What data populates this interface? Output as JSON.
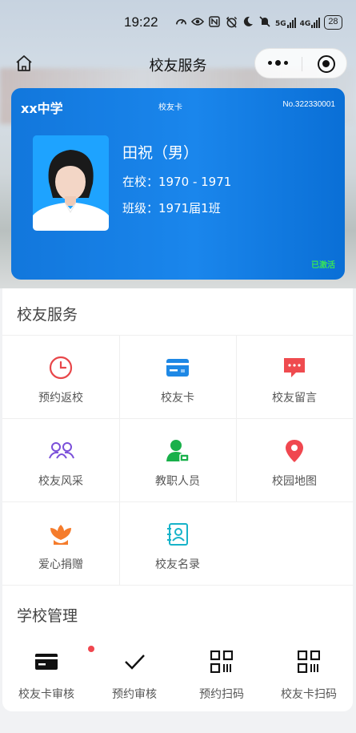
{
  "status_bar": {
    "time": "19:22",
    "signal1": "5G",
    "signal2": "4G",
    "battery": "28"
  },
  "nav": {
    "title": "校友服务"
  },
  "card": {
    "school": "xx中学",
    "card_type": "校友卡",
    "number": "No.322330001",
    "name": "田祝（男）",
    "school_years": "在校：1970 - 1971",
    "class": "班级：1971届1班",
    "status": "已激活"
  },
  "alumni_services": {
    "title": "校友服务",
    "items": [
      {
        "label": "预约返校",
        "icon": "clock-icon",
        "color": "#e8474a"
      },
      {
        "label": "校友卡",
        "icon": "card-icon",
        "color": "#1e88e5"
      },
      {
        "label": "校友留言",
        "icon": "message-icon",
        "color": "#ef4b4f"
      },
      {
        "label": "校友风采",
        "icon": "people-icon",
        "color": "#7a4fd9"
      },
      {
        "label": "教职人员",
        "icon": "staff-icon",
        "color": "#19b04a"
      },
      {
        "label": "校园地图",
        "icon": "map-pin-icon",
        "color": "#f0474f"
      },
      {
        "label": "爱心捐赠",
        "icon": "donate-icon",
        "color": "#f57c2c"
      },
      {
        "label": "校友名录",
        "icon": "directory-icon",
        "color": "#16b3c9"
      }
    ]
  },
  "school_management": {
    "title": "学校管理",
    "items": [
      {
        "label": "校友卡审核",
        "icon": "card-review-icon"
      },
      {
        "label": "预约审核",
        "icon": "check-icon"
      },
      {
        "label": "预约扫码",
        "icon": "qr-scan-icon"
      },
      {
        "label": "校友卡扫码",
        "icon": "qr-scan-icon"
      }
    ]
  }
}
